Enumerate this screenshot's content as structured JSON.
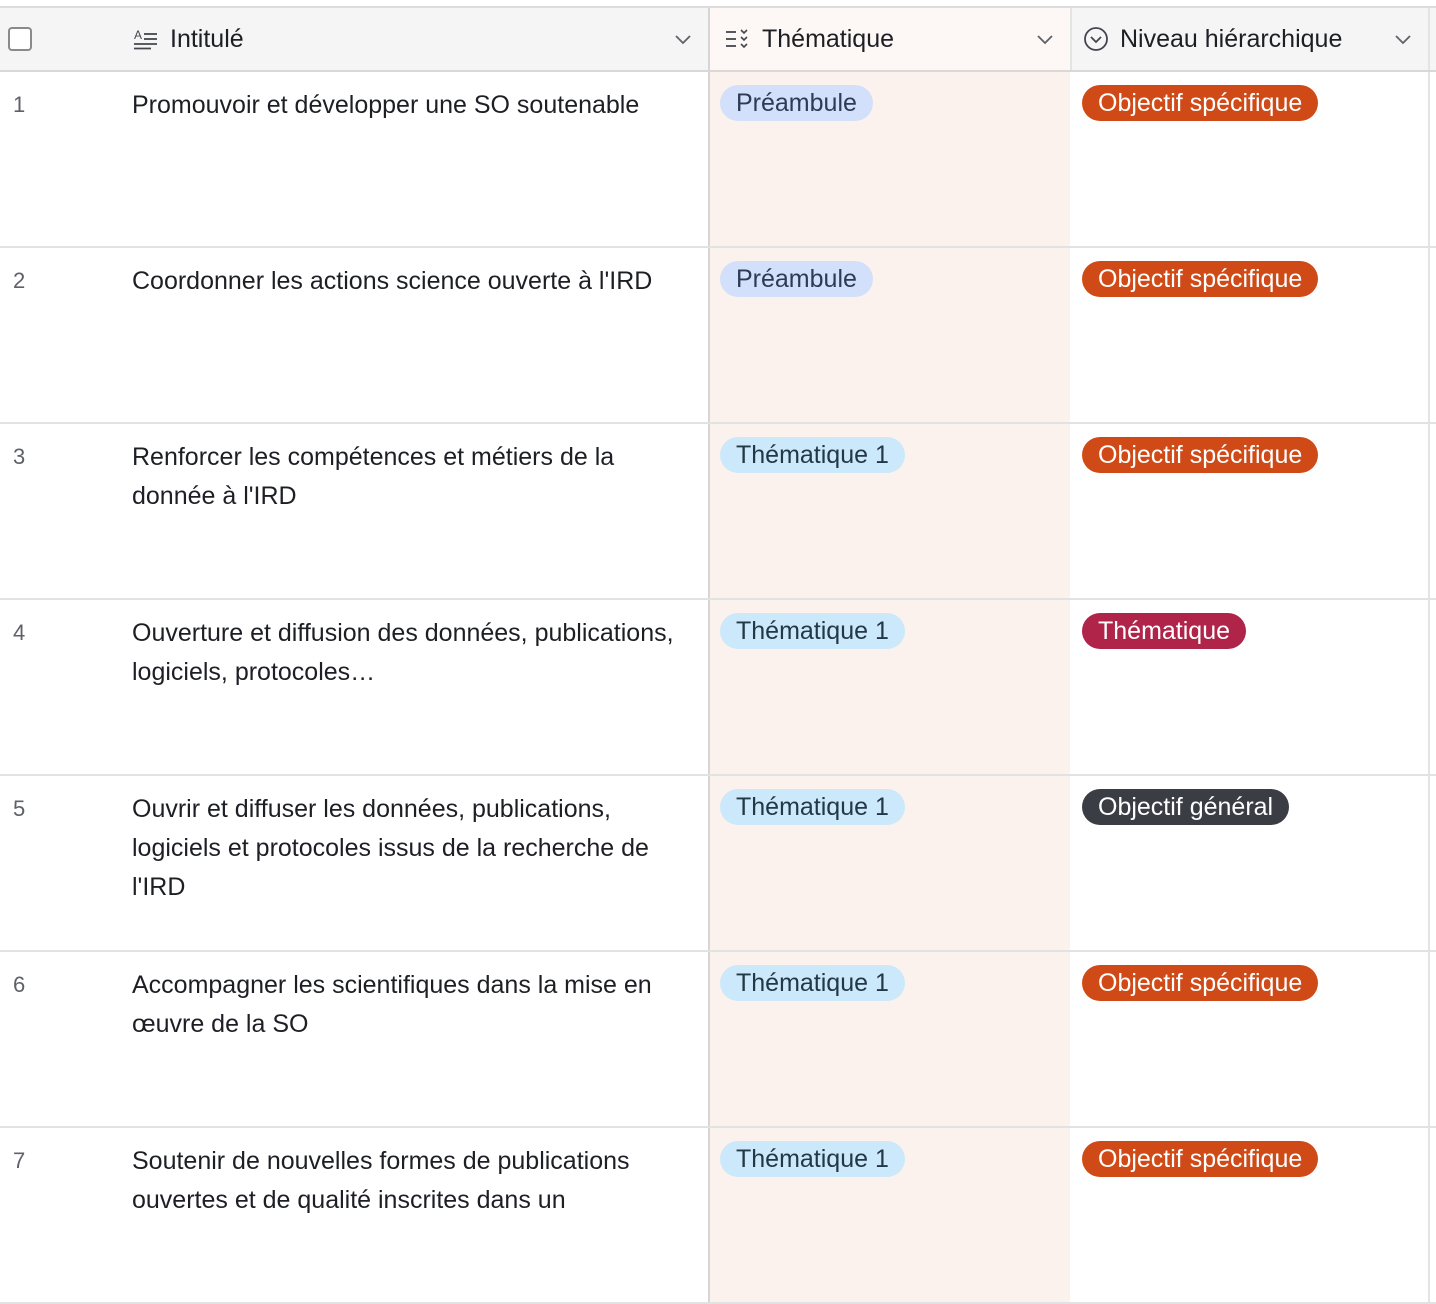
{
  "header": {
    "col_intitule": "Intitulé",
    "col_thematique": "Thématique",
    "col_niveau": "Niveau hiérarchique"
  },
  "colors": {
    "preambule_bg": "#d3e0fb",
    "thematique1_bg": "#cbe9fb",
    "objectif_specifique_bg": "#cf4a17",
    "thematique_bg": "#b0244a",
    "objectif_general_bg": "#3b3d44"
  },
  "rows": [
    {
      "num": "1",
      "intitule": "Promouvoir et développer une SO soutenable",
      "thematique": "Préambule",
      "niveau": "Objectif spécifique"
    },
    {
      "num": "2",
      "intitule": "Coordonner les actions science ouverte à l'IRD",
      "thematique": "Préambule",
      "niveau": "Objectif spécifique"
    },
    {
      "num": "3",
      "intitule": "Renforcer les compétences et métiers de la donnée à l'IRD",
      "thematique": "Thématique 1",
      "niveau": "Objectif spécifique"
    },
    {
      "num": "4",
      "intitule": "Ouverture et diffusion des données, publications, logiciels, protocoles…",
      "thematique": "Thématique 1",
      "niveau": "Thématique"
    },
    {
      "num": "5",
      "intitule": "Ouvrir et diffuser les données, publications, logiciels et protocoles issus de la recherche de l'IRD",
      "thematique": "Thématique 1",
      "niveau": "Objectif général"
    },
    {
      "num": "6",
      "intitule": "Accompagner les scientifiques dans la mise en œuvre de la SO",
      "thematique": "Thématique 1",
      "niveau": "Objectif spécifique"
    },
    {
      "num": "7",
      "intitule": "Soutenir de nouvelles formes de publications ouvertes et de qualité inscrites dans un",
      "thematique": "Thématique 1",
      "niveau": "Objectif spécifique"
    }
  ]
}
